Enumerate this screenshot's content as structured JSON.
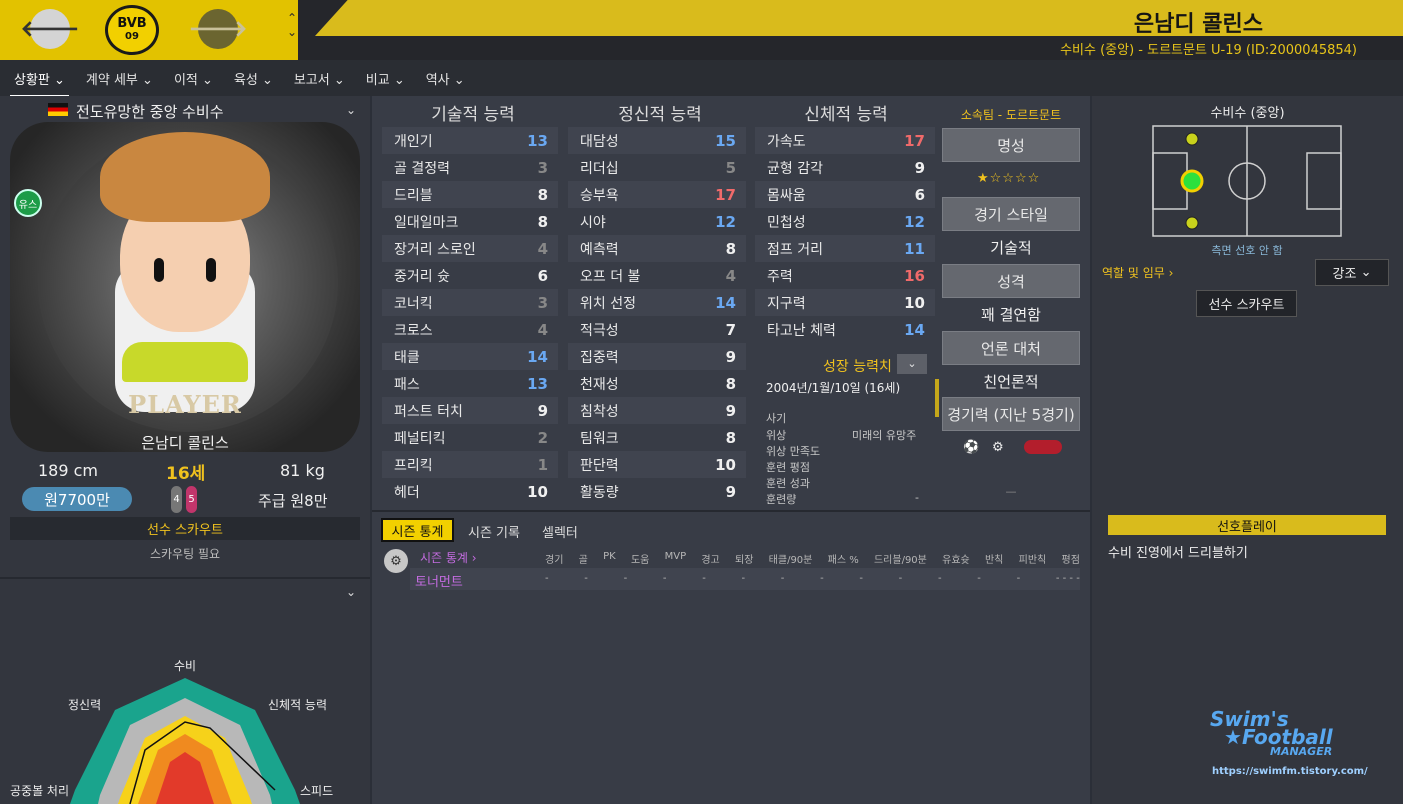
{
  "header": {
    "name": "은남디 콜린스",
    "subtitle": "수비수 (중앙) - 도르트문트 U-19 (ID:2000045854)",
    "crest_top": "BVB",
    "crest_bottom": "09",
    "back_icon": "arrow-left-icon",
    "forward_icon": "arrow-right-icon"
  },
  "menu": [
    "상황판",
    "계약 세부",
    "이적",
    "육성",
    "보고서",
    "비교",
    "역사"
  ],
  "profile": {
    "title": "전도유망한 중앙 수비수",
    "youth_badge": "유스",
    "card_text": "PLAYER",
    "name": "은남디 콜린스",
    "height": "189 cm",
    "age": "16세",
    "weight": "81 kg",
    "value": "원7700만",
    "rating_a": "4",
    "rating_b": "5",
    "wage": "주급 원8만",
    "scout_title": "선수 스카우트",
    "scout_note": "스카우팅 필요"
  },
  "radar": {
    "labels": [
      "수비",
      "신체적 능력",
      "스피드",
      "공중볼 처리",
      "정신력"
    ]
  },
  "attributes": {
    "technical": {
      "title": "기술적 능력",
      "items": [
        [
          "개인기",
          "13",
          "blue"
        ],
        [
          "골 결정력",
          "3",
          "grey"
        ],
        [
          "드리블",
          "8",
          "white"
        ],
        [
          "일대일마크",
          "8",
          "white"
        ],
        [
          "장거리 스로인",
          "4",
          "grey"
        ],
        [
          "중거리 슛",
          "6",
          "white"
        ],
        [
          "코너킥",
          "3",
          "grey"
        ],
        [
          "크로스",
          "4",
          "grey"
        ],
        [
          "태클",
          "14",
          "blue"
        ],
        [
          "패스",
          "13",
          "blue"
        ],
        [
          "퍼스트 터치",
          "9",
          "white"
        ],
        [
          "페널티킥",
          "2",
          "grey"
        ],
        [
          "프리킥",
          "1",
          "grey"
        ],
        [
          "헤더",
          "10",
          "white"
        ]
      ]
    },
    "mental": {
      "title": "정신적 능력",
      "items": [
        [
          "대담성",
          "15",
          "blue"
        ],
        [
          "리더십",
          "5",
          "grey"
        ],
        [
          "승부욕",
          "17",
          "red"
        ],
        [
          "시야",
          "12",
          "blue"
        ],
        [
          "예측력",
          "8",
          "white"
        ],
        [
          "오프 더 볼",
          "4",
          "grey"
        ],
        [
          "위치 선정",
          "14",
          "blue"
        ],
        [
          "적극성",
          "7",
          "white"
        ],
        [
          "집중력",
          "9",
          "white"
        ],
        [
          "천재성",
          "8",
          "white"
        ],
        [
          "침착성",
          "9",
          "white"
        ],
        [
          "팀워크",
          "8",
          "white"
        ],
        [
          "판단력",
          "10",
          "white"
        ],
        [
          "활동량",
          "9",
          "white"
        ]
      ]
    },
    "physical": {
      "title": "신체적 능력",
      "items": [
        [
          "가속도",
          "17",
          "red"
        ],
        [
          "균형 감각",
          "9",
          "white"
        ],
        [
          "몸싸움",
          "6",
          "white"
        ],
        [
          "민첩성",
          "12",
          "blue"
        ],
        [
          "점프 거리",
          "11",
          "blue"
        ],
        [
          "주력",
          "16",
          "red"
        ],
        [
          "지구력",
          "10",
          "white"
        ],
        [
          "타고난 체력",
          "14",
          "blue"
        ]
      ]
    }
  },
  "growth": {
    "title": "성장 능력치",
    "birth": "2004년/1월/10일 (16세)",
    "labels": [
      "사기",
      "위상",
      "위상 만족도",
      "훈련 평점",
      "훈련 성과",
      "훈련량"
    ],
    "status_value": "미래의 유망주",
    "dash": "-"
  },
  "club": {
    "label": "소속팀 - 도르트문트",
    "fame_btn": "명성",
    "stars": "★☆☆☆☆",
    "style_btn": "경기 스타일",
    "style_val": "기술적",
    "pers_btn": "성격",
    "pers_val": "꽤 결연함",
    "media_btn": "언론 대처",
    "media_val": "친언론적",
    "form_btn": "경기력 (지난 5경기)",
    "dash": "—"
  },
  "position": {
    "title": "수비수 (중앙)",
    "note": "측면 선호 안 함",
    "roles": "역할 및 임무 ›",
    "emphasis": "강조",
    "scout_btn": "선수 스카우트"
  },
  "stats": {
    "tabs": [
      "시즌 통계",
      "시즌 기록",
      "셀렉터"
    ],
    "link": "시즌 통계 ›",
    "headers": [
      "경기",
      "골",
      "PK",
      "도움",
      "MVP",
      "경고",
      "퇴장",
      "태클/90분",
      "패스 %",
      "드리블/90분",
      "유효슛",
      "반칙",
      "피반칙",
      "평점"
    ],
    "row_name": "토너먼트",
    "row_values": [
      "-",
      "-",
      "-",
      "-",
      "-",
      "-",
      "-",
      "-",
      "-",
      "-",
      "-",
      "-",
      "-",
      "- - - -"
    ]
  },
  "preferred": {
    "title": "선호플레이",
    "item": "수비 진영에서 드리블하기"
  },
  "watermark": {
    "l1": "Swim's",
    "l2": "Football",
    "l3": "MANAGER",
    "url": "https://swimfm.tistory.com/"
  }
}
